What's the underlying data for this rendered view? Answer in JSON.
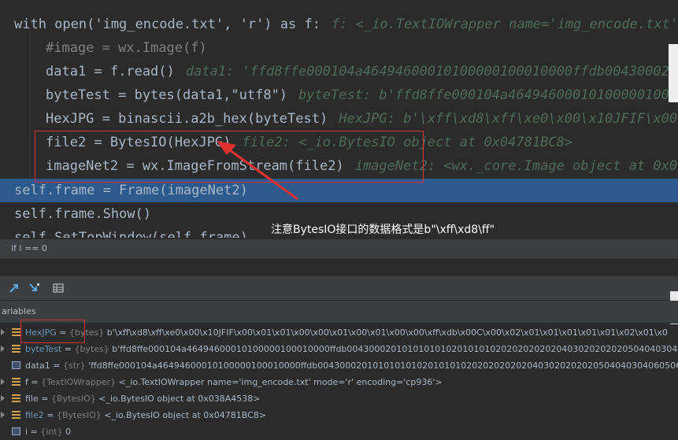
{
  "editor": {
    "lines": [
      {
        "id": "l1",
        "code": "with open('img_encode.txt', 'r') as f:",
        "hint": "f: <_io.TextIOWrapper name='img_encode.txt' m"
      },
      {
        "id": "l2",
        "code": "#image = wx.Image(f)",
        "hint": ""
      },
      {
        "id": "l3",
        "code": "data1 = f.read()",
        "hint": "data1: 'ffd8ffe000104a46494600010100000100010000ffdb00430002010"
      },
      {
        "id": "l4",
        "code": "byteTest = bytes(data1,\"utf8\")",
        "hint": "byteTest: b'ffd8ffe000104a464946000101000001000"
      },
      {
        "id": "l5",
        "code": "HexJPG = binascii.a2b_hex(byteTest)",
        "hint": "HexJPG: b'\\xff\\xd8\\xff\\xe0\\x00\\x10JFIF\\x00"
      },
      {
        "id": "l6",
        "code": "file2 = BytesIO(HexJPG)",
        "hint": "file2: <_io.BytesIO object at 0x04781BC8>"
      },
      {
        "id": "l7",
        "code": "imageNet2 = wx.ImageFromStream(file2)",
        "hint": "imageNet2: <wx._core.Image object at 0x0"
      },
      {
        "id": "l8",
        "code": "self.frame = Frame(imageNet2)",
        "hint": ""
      },
      {
        "id": "l9",
        "code": "self.frame.Show()",
        "hint": ""
      },
      {
        "id": "l10",
        "code": "self.SetTopWindow(self.frame)",
        "hint": ""
      }
    ]
  },
  "annotation": "注意BytesIO接口的数据格式是b\"\\xff\\xd8\\ff\"",
  "breadcrumb": "if i == 0",
  "vars_header": "ariables",
  "variables": [
    {
      "name": "HexJPG",
      "type": "{bytes}",
      "value": "b'\\xff\\xd8\\xff\\xe0\\x00\\x10JFIF\\x00\\x01\\x01\\x00\\x00\\x01\\x00\\x01\\x00\\x00\\xff\\xdb\\x00C\\x00\\x02\\x01\\x01\\x01\\x01\\x01\\x02\\x01\\x0"
    },
    {
      "name": "byteTest",
      "type": "{bytes}",
      "value": "b'ffd8ffe000104a46494600010100000100010000ffdb0043000201010101010201010102020202020204030202020205040403040"
    },
    {
      "name": "data1",
      "type": "{str}",
      "value": "'ffd8ffe000104a46494600010100000100010000ffdb0043000201010101010201010102020202020204030202020205040403040605060"
    },
    {
      "name": "f",
      "type": "{TextIOWrapper}",
      "value": "<_io.TextIOWrapper name='img_encode.txt' mode='r' encoding='cp936'>"
    },
    {
      "name": "file",
      "type": "{BytesIO}",
      "value": "<_io.BytesIO object at 0x038A4538>"
    },
    {
      "name": "file2",
      "type": "{BytesIO}",
      "value": "<_io.BytesIO object at 0x04781BC8>"
    },
    {
      "name": "i",
      "type": "{int}",
      "value": "0"
    }
  ],
  "colors": {
    "accent_red": "#e03131",
    "current_line": "#2d5a8c"
  }
}
